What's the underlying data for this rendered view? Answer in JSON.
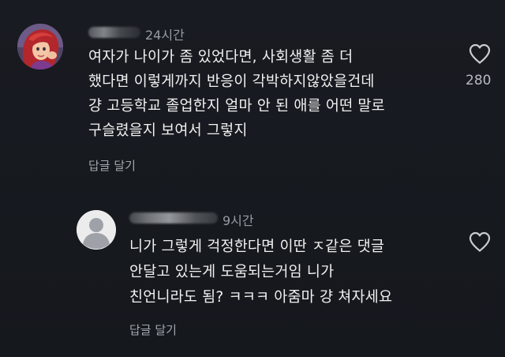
{
  "comments": [
    {
      "time": "24시간",
      "lines": [
        "여자가 나이가 좀 있었다면, 사회생활 좀 더",
        "했다면 이렇게까지 반응이 각박하지않았을건데",
        "걍 고등학교 졸업한지 얼마 안 된 애를 어떤 말로",
        "구슬렸을지 보여서 그렇지"
      ],
      "reply_label": "답글 달기",
      "like_count": "280",
      "like_icon": "heart-outline-icon",
      "avatar_icon": "cartoon-avatar"
    },
    {
      "time": "9시간",
      "lines": [
        "니가 그렇게 걱정한다면 이딴 ㅈ같은 댓글",
        "안달고 있는게 도움되는거임 니가",
        "친언니라도 됨? ㅋㅋㅋ 아줌마 걍 쳐자세요"
      ],
      "reply_label": "답글 달기",
      "like_icon": "heart-outline-icon",
      "avatar_icon": "default-profile-icon"
    }
  ],
  "colors": {
    "background": "#171a20",
    "text": "#f1f1f1",
    "muted": "#989ca3"
  }
}
